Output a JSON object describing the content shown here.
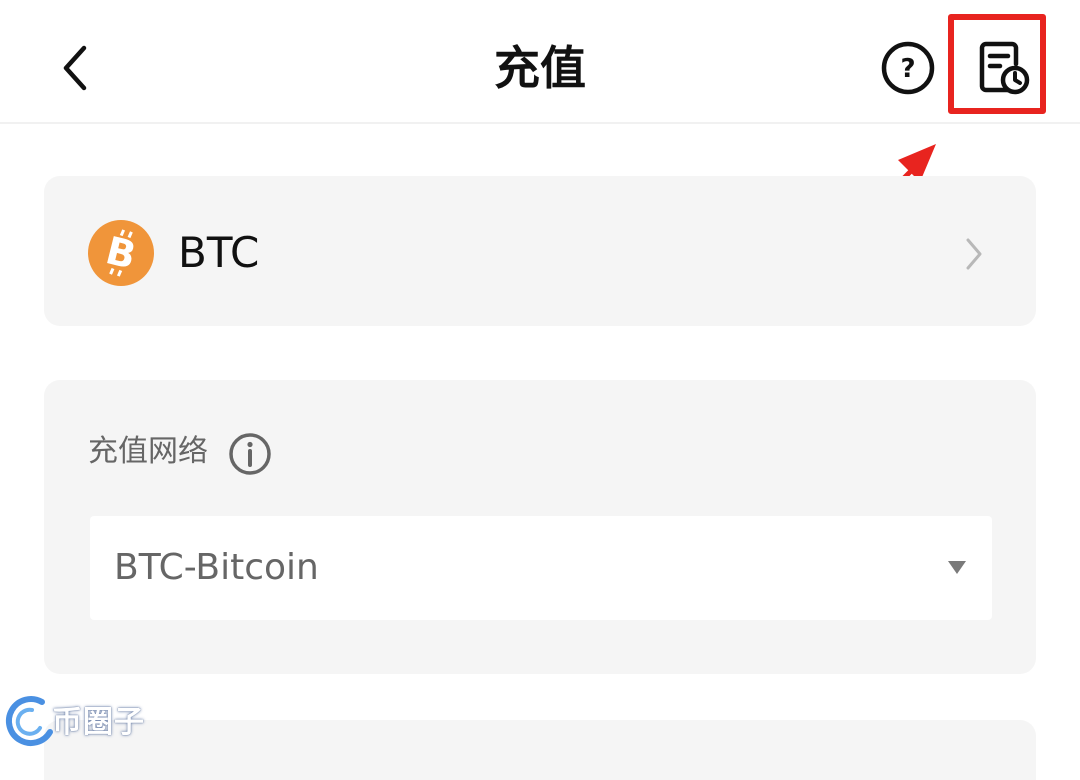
{
  "header": {
    "title": "充值",
    "back_icon": "chevron-left-icon",
    "help_icon": "help-circle-icon",
    "history_icon": "record-history-icon"
  },
  "annotation": {
    "highlight_color": "#e8241f"
  },
  "coin": {
    "symbol": "BTC",
    "icon": "bitcoin-icon",
    "icon_color": "#f0953a"
  },
  "network": {
    "label": "充值网络",
    "info_icon": "info-icon",
    "selected": "BTC-Bitcoin"
  },
  "watermark": {
    "text": "币圈子"
  }
}
